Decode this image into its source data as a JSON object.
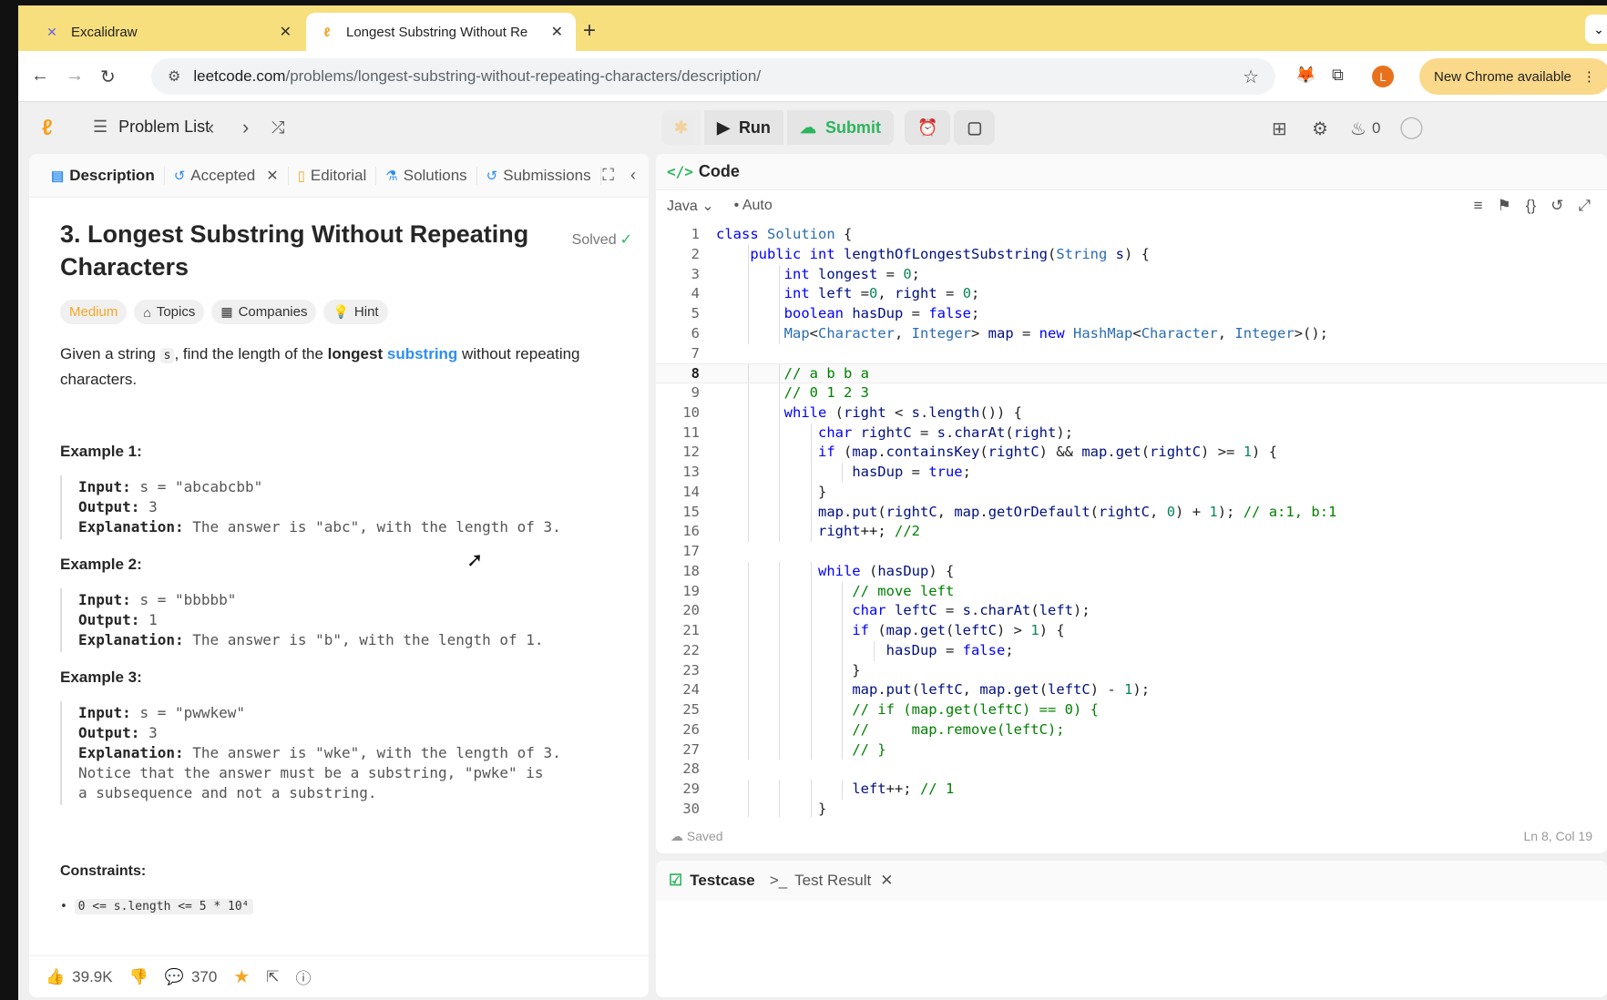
{
  "browser": {
    "tabs": [
      {
        "title": "Excalidraw",
        "icon": "excalidraw-icon",
        "active": false
      },
      {
        "title": "Longest Substring Without Re",
        "icon": "leetcode-icon",
        "active": true
      }
    ],
    "url_host": "leetcode.com",
    "url_path": "/problems/longest-substring-without-repeating-characters/description/",
    "profile_initial": "L",
    "new_chrome_label": "New Chrome available"
  },
  "header": {
    "problem_list_label": "Problem List",
    "run_label": "Run",
    "submit_label": "Submit",
    "streak_count": "0"
  },
  "left_tabs": [
    {
      "label": "Description",
      "icon": "description-icon",
      "active": true
    },
    {
      "label": "Accepted",
      "icon": "history-icon",
      "active": false,
      "closable": true
    },
    {
      "label": "Editorial",
      "icon": "book-icon",
      "active": false
    },
    {
      "label": "Solutions",
      "icon": "flask-icon",
      "active": false
    },
    {
      "label": "Submissions",
      "icon": "history-icon",
      "active": false
    }
  ],
  "problem": {
    "title": "3. Longest Substring Without Repeating Characters",
    "solved_label": "Solved",
    "difficulty": "Medium",
    "chips": [
      "Topics",
      "Companies",
      "Hint"
    ],
    "desc_before": "Given a string ",
    "desc_var": "s",
    "desc_mid": ", find the length of the ",
    "desc_bold": "longest",
    "desc_link": "substring",
    "desc_after": " without repeating characters.",
    "examples": [
      {
        "heading": "Example 1:",
        "input": "s = \"abcabcbb\"",
        "output": "3",
        "explanation": "The answer is \"abc\", with the length of 3.",
        "extra": ""
      },
      {
        "heading": "Example 2:",
        "input": "s = \"bbbbb\"",
        "output": "1",
        "explanation": "The answer is \"b\", with the length of 1.",
        "extra": ""
      },
      {
        "heading": "Example 3:",
        "input": "s = \"pwwkew\"",
        "output": "3",
        "explanation": "The answer is \"wke\", with the length of 3.",
        "extra": "Notice that the answer must be a substring, \"pwke\" is a subsequence and not a substring."
      }
    ],
    "input_key": "Input:",
    "output_key": "Output:",
    "explanation_key": "Explanation:",
    "constraints_heading": "Constraints:",
    "constraint_1": "0 <= s.length <= 5 * 10⁴"
  },
  "footer": {
    "likes": "39.9K",
    "comments": "370"
  },
  "code_panel": {
    "title": "Code",
    "language": "Java",
    "mode": "Auto",
    "saved_label": "Saved",
    "cursor_pos": "Ln 8, Col 19",
    "current_line": 8
  },
  "code_lines": [
    "class Solution {",
    "    public int lengthOfLongestSubstring(String s) {",
    "        int longest = 0;",
    "        int left =0, right = 0;",
    "        boolean hasDup = false;",
    "        Map<Character, Integer> map = new HashMap<Character, Integer>();",
    "",
    "        // a b b a",
    "        // 0 1 2 3",
    "        while (right < s.length()) {",
    "            char rightC = s.charAt(right);",
    "            if (map.containsKey(rightC) && map.get(rightC) >= 1) {",
    "                hasDup = true;",
    "            }",
    "            map.put(rightC, map.getOrDefault(rightC, 0) + 1); // a:1, b:1",
    "            right++; //2",
    "",
    "            while (hasDup) {",
    "                // move left",
    "                char leftC = s.charAt(left);",
    "                if (map.get(leftC) > 1) {",
    "                    hasDup = false;",
    "                }",
    "                map.put(leftC, map.get(leftC) - 1);",
    "                // if (map.get(leftC) == 0) {",
    "                //     map.remove(leftC);",
    "                // }",
    "",
    "                left++; // 1",
    "            }"
  ],
  "test_tabs": [
    {
      "label": "Testcase",
      "active": true
    },
    {
      "label": "Test Result",
      "active": false
    }
  ]
}
